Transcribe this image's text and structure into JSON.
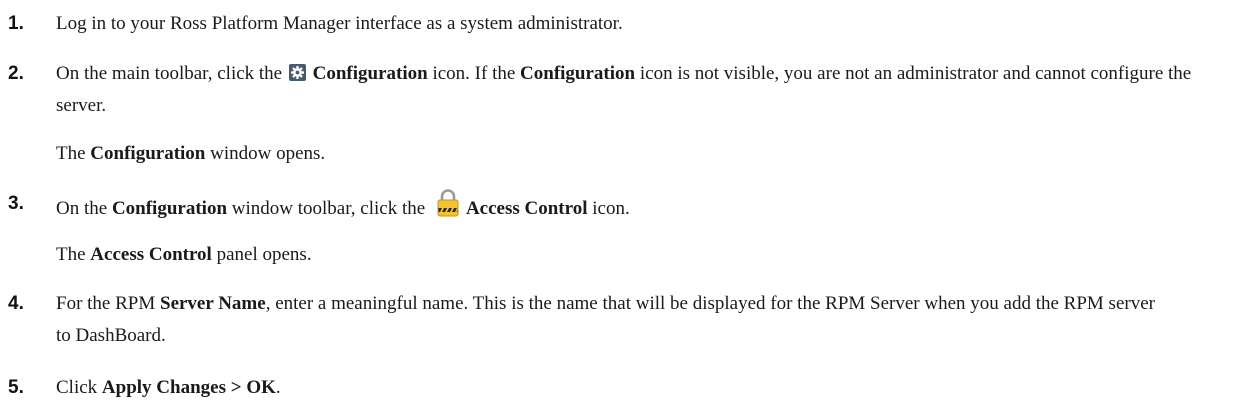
{
  "steps": [
    {
      "number": "1.",
      "text": "Log in to your Ross Platform Manager interface as a system administrator."
    },
    {
      "number": "2.",
      "pre": "On the main toolbar, click the ",
      "icon": "gear-icon",
      "icon_label": "Configuration",
      "mid": " icon. If the ",
      "bold2": "Configuration",
      "post": " icon is not visible, you are not an administrator and cannot configure the server.",
      "result_bold": "Configuration",
      "result_rest": " window opens."
    },
    {
      "number": "3.",
      "pre": "On the ",
      "bold1": "Configuration",
      "mid": " window toolbar, click the ",
      "icon": "lock-icon",
      "icon_label": "Access Control",
      "post": " icon.",
      "result_pre": "The ",
      "result_bold": "Access Control",
      "result_rest": " panel opens."
    },
    {
      "number": "4.",
      "pre": "For the RPM ",
      "bold1": "Server Name",
      "post": ", enter a meaningful name. This is the name that will be displayed for the RPM Server when you add the RPM server to DashBoard."
    },
    {
      "number": "5.",
      "pre": "Click ",
      "bold1": "Apply Changes > OK",
      "post": "."
    }
  ],
  "colors": {
    "text": "#1a1a1a",
    "gear_bg": "#4a5a6e",
    "lock_body": "#f2c230",
    "lock_stripe": "#2a2a2a"
  }
}
